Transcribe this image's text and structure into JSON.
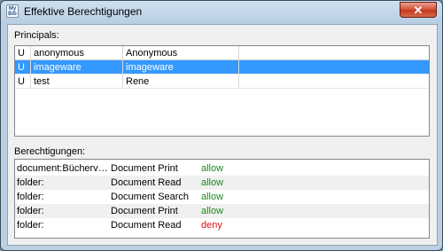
{
  "window": {
    "title": "Effektive Berechtigungen",
    "icon_text": [
      "My",
      "Bib"
    ],
    "close_label": "✕"
  },
  "principals": {
    "label": "Principals:",
    "columns": [
      "U",
      "anonymous",
      "Anonymous"
    ],
    "rows": [
      {
        "type": "U",
        "name": "imageware",
        "display": "imageware",
        "selected": true
      },
      {
        "type": "U",
        "name": "test",
        "display": "Rene",
        "selected": false
      }
    ]
  },
  "permissions": {
    "label": "Berechtigungen:",
    "rows": [
      {
        "object": "document:Bücherver...",
        "action": "Document Print",
        "result": "allow"
      },
      {
        "object": "folder:",
        "action": "Document Read",
        "result": "allow"
      },
      {
        "object": "folder:",
        "action": "Document Search",
        "result": "allow"
      },
      {
        "object": "folder:",
        "action": "Document Print",
        "result": "allow"
      },
      {
        "object": "folder:",
        "action": "Document Read",
        "result": "deny"
      }
    ]
  },
  "colors": {
    "allow": "#1a8a1a",
    "deny": "#e01010",
    "selection": "#3399ff"
  }
}
